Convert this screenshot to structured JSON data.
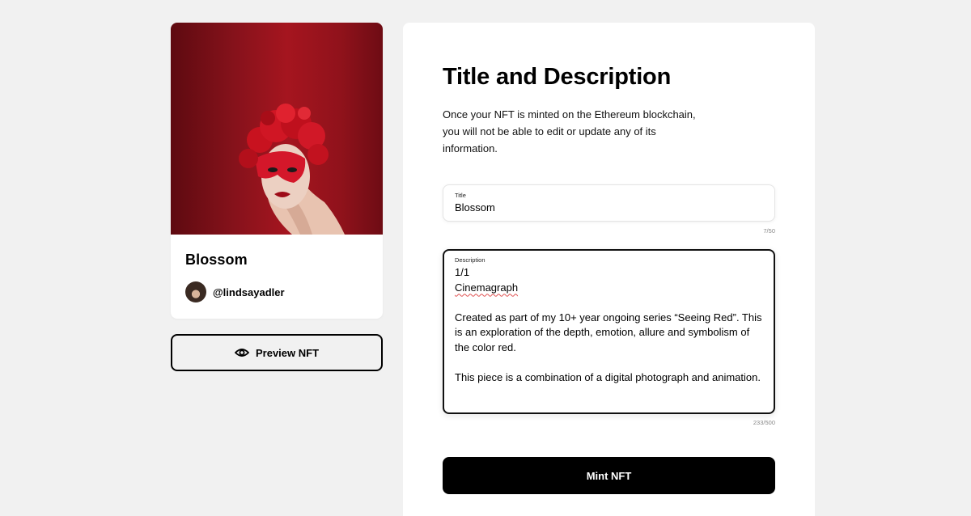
{
  "nft_card": {
    "title": "Blossom",
    "creator_handle": "@lindsayadler"
  },
  "preview_button": {
    "label": "Preview NFT",
    "icon": "eye-icon"
  },
  "panel": {
    "heading": "Title and Description",
    "intro": "Once your NFT is minted on the Ethereum blockchain, you will not be able to edit or update any of its information."
  },
  "title_field": {
    "label": "Title",
    "value": "Blossom",
    "counter": "7/50"
  },
  "description_field": {
    "label": "Description",
    "lines": [
      "1/1",
      "Cinemagraph",
      "",
      "Created as part of my 10+ year ongoing series “Seeing Red”. This is an exploration of the depth, emotion, allure and symbolism of the color red.",
      "",
      "This piece is a combination of a digital photograph and animation."
    ],
    "counter": "233/500"
  },
  "mint_button": {
    "label": "Mint NFT"
  },
  "colors": {
    "page_background": "#f1f1f1",
    "artwork_red": "#a5151f",
    "primary_button": "#000000",
    "spellcheck_underline": "#e05050"
  }
}
